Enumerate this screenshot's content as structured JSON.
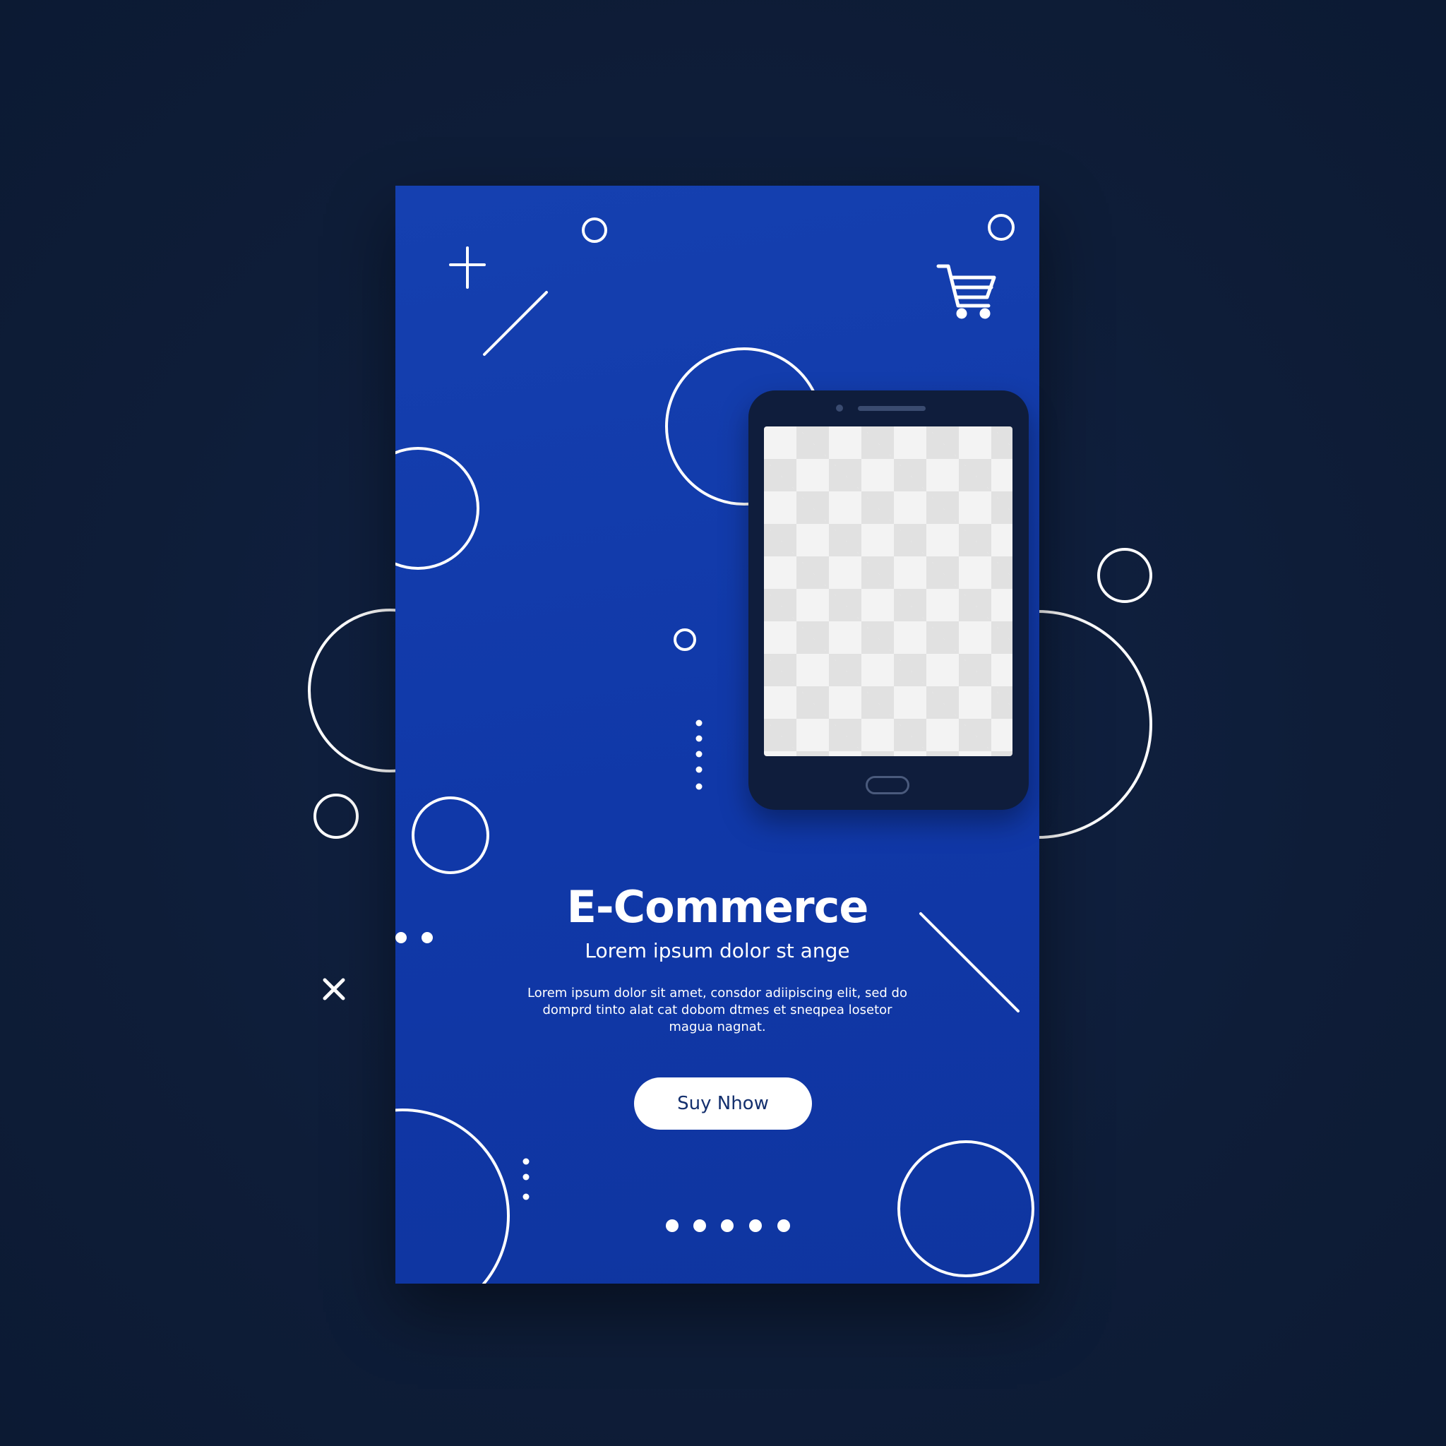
{
  "colors": {
    "background": "#0e1d38",
    "card": "#1038a8",
    "phone_body": "#0f1d3c",
    "accent_white": "#ffffff",
    "button_text": "#14306e"
  },
  "banner": {
    "title": "E-Commerce",
    "subtitle": "Lorem ipsum dolor st ange",
    "body": "Lorem ipsum dolor sit amet, consdor adiipiscing elit, sed do domprd tinto alat cat dobom dtmes et sneqpea losetor magua nagnat.",
    "cta_label": "Suy Nhow"
  },
  "icons": {
    "cart": "shopping-cart-icon",
    "phone": "smartphone-mockup",
    "plus": "plus-icon",
    "close": "close-icon"
  }
}
